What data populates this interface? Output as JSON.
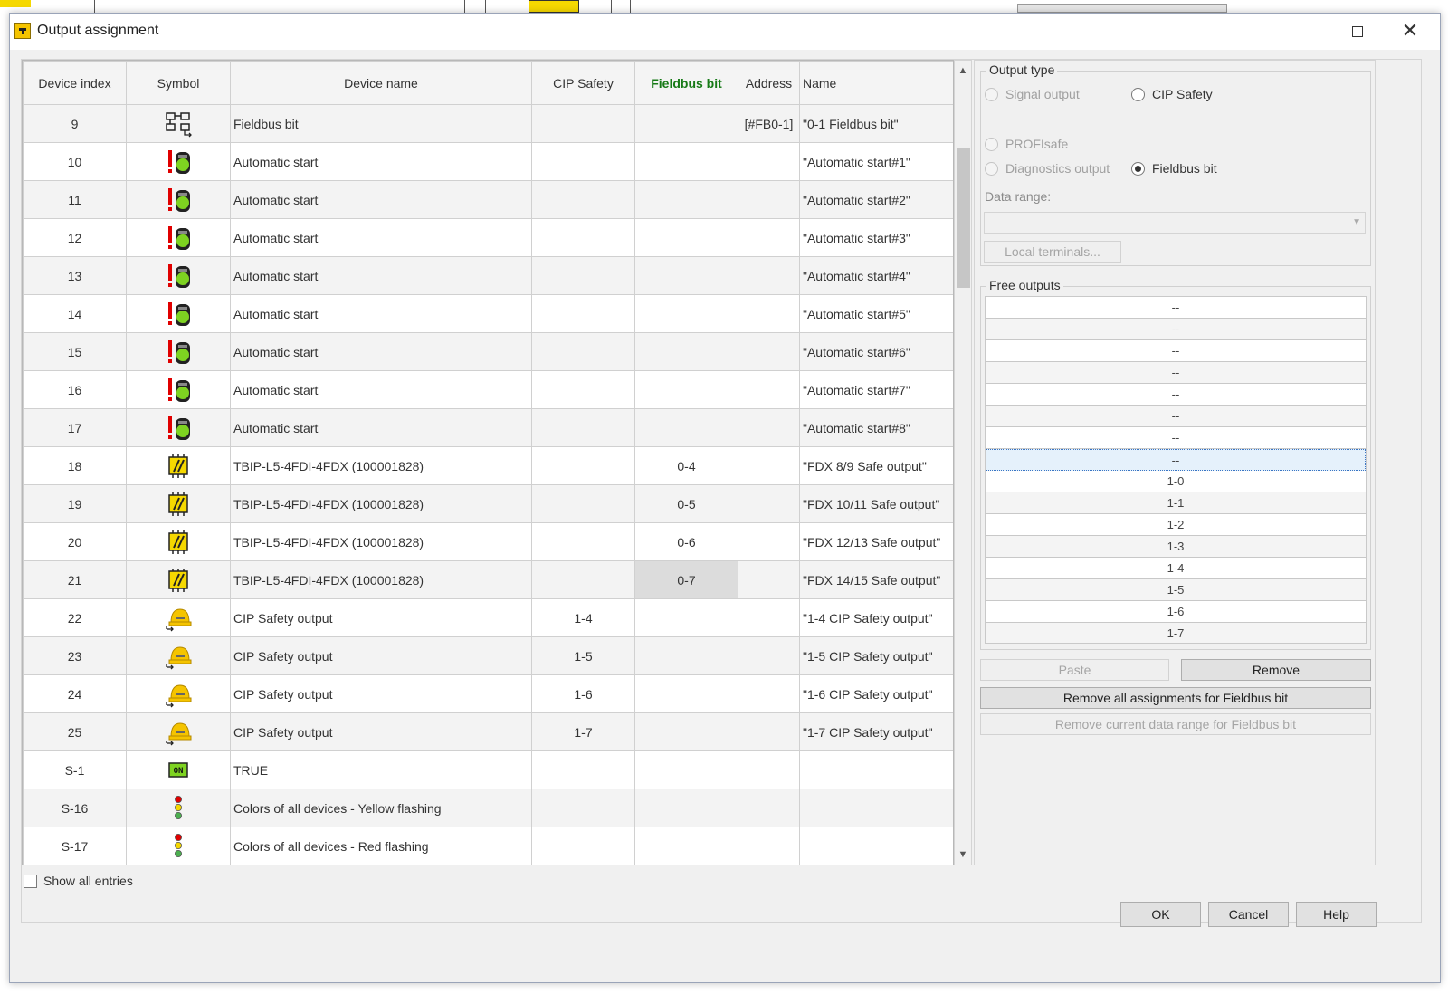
{
  "window": {
    "title": "Output assignment"
  },
  "columns": [
    "Device index",
    "Symbol",
    "Device name",
    "CIP Safety",
    "Fieldbus bit",
    "Address",
    "Name"
  ],
  "rows": [
    {
      "index": "9",
      "icon": "fieldbus-icon",
      "device": "Fieldbus bit",
      "cip": "",
      "fb": "",
      "addr": "[#FB0-1]",
      "name": "\"0-1 Fieldbus bit\""
    },
    {
      "index": "10",
      "icon": "automatic-start-icon",
      "device": "Automatic start",
      "cip": "",
      "fb": "",
      "addr": "",
      "name": "\"Automatic start#1\""
    },
    {
      "index": "11",
      "icon": "automatic-start-icon",
      "device": "Automatic start",
      "cip": "",
      "fb": "",
      "addr": "",
      "name": "\"Automatic start#2\""
    },
    {
      "index": "12",
      "icon": "automatic-start-icon",
      "device": "Automatic start",
      "cip": "",
      "fb": "",
      "addr": "",
      "name": "\"Automatic start#3\""
    },
    {
      "index": "13",
      "icon": "automatic-start-icon",
      "device": "Automatic start",
      "cip": "",
      "fb": "",
      "addr": "",
      "name": "\"Automatic start#4\""
    },
    {
      "index": "14",
      "icon": "automatic-start-icon",
      "device": "Automatic start",
      "cip": "",
      "fb": "",
      "addr": "",
      "name": "\"Automatic start#5\""
    },
    {
      "index": "15",
      "icon": "automatic-start-icon",
      "device": "Automatic start",
      "cip": "",
      "fb": "",
      "addr": "",
      "name": "\"Automatic start#6\""
    },
    {
      "index": "16",
      "icon": "automatic-start-icon",
      "device": "Automatic start",
      "cip": "",
      "fb": "",
      "addr": "",
      "name": "\"Automatic start#7\""
    },
    {
      "index": "17",
      "icon": "automatic-start-icon",
      "device": "Automatic start",
      "cip": "",
      "fb": "",
      "addr": "",
      "name": "\"Automatic start#8\""
    },
    {
      "index": "18",
      "icon": "safe-output-module-icon",
      "device": "TBIP-L5-4FDI-4FDX (100001828)",
      "cip": "",
      "fb": "0-4",
      "addr": "",
      "name": "\"FDX 8/9 Safe output\""
    },
    {
      "index": "19",
      "icon": "safe-output-module-icon",
      "device": "TBIP-L5-4FDI-4FDX (100001828)",
      "cip": "",
      "fb": "0-5",
      "addr": "",
      "name": "\"FDX 10/11 Safe output\""
    },
    {
      "index": "20",
      "icon": "safe-output-module-icon",
      "device": "TBIP-L5-4FDI-4FDX (100001828)",
      "cip": "",
      "fb": "0-6",
      "addr": "",
      "name": "\"FDX 12/13 Safe output\""
    },
    {
      "index": "21",
      "icon": "safe-output-module-icon",
      "device": "TBIP-L5-4FDI-4FDX (100001828)",
      "cip": "",
      "fb": "0-7",
      "addr": "",
      "name": "\"FDX 14/15 Safe output\"",
      "selected_cell": "fb"
    },
    {
      "index": "22",
      "icon": "cip-safety-output-icon",
      "device": "CIP Safety output",
      "cip": "1-4",
      "fb": "",
      "addr": "",
      "name": "\"1-4 CIP Safety output\""
    },
    {
      "index": "23",
      "icon": "cip-safety-output-icon",
      "device": "CIP Safety output",
      "cip": "1-5",
      "fb": "",
      "addr": "",
      "name": "\"1-5 CIP Safety output\""
    },
    {
      "index": "24",
      "icon": "cip-safety-output-icon",
      "device": "CIP Safety output",
      "cip": "1-6",
      "fb": "",
      "addr": "",
      "name": "\"1-6 CIP Safety output\""
    },
    {
      "index": "25",
      "icon": "cip-safety-output-icon",
      "device": "CIP Safety output",
      "cip": "1-7",
      "fb": "",
      "addr": "",
      "name": "\"1-7 CIP Safety output\""
    },
    {
      "index": "S-1",
      "icon": "true-on-icon",
      "icon_text": "ON",
      "device": "TRUE",
      "cip": "",
      "fb": "",
      "addr": "",
      "name": ""
    },
    {
      "index": "S-16",
      "icon": "traffic-light-icon",
      "device": "Colors of all devices - Yellow flashing",
      "cip": "",
      "fb": "",
      "addr": "",
      "name": ""
    },
    {
      "index": "S-17",
      "icon": "traffic-light-icon",
      "device": "Colors of all devices - Red flashing",
      "cip": "",
      "fb": "",
      "addr": "",
      "name": ""
    }
  ],
  "show_all": {
    "label": "Show all entries",
    "checked": false
  },
  "output_type": {
    "legend": "Output type",
    "options": [
      {
        "label": "Signal output",
        "enabled": false,
        "checked": false
      },
      {
        "label": "CIP Safety",
        "enabled": true,
        "checked": false
      },
      {
        "label": "PROFIsafe",
        "enabled": false,
        "checked": false
      },
      {
        "label": "Diagnostics output",
        "enabled": false,
        "checked": false
      },
      {
        "label": "Fieldbus bit",
        "enabled": true,
        "checked": true
      }
    ],
    "data_range_label": "Data range:",
    "data_range_value": "",
    "local_terminals_label": "Local terminals..."
  },
  "free_outputs": {
    "legend": "Free outputs",
    "items": [
      "--",
      "--",
      "--",
      "--",
      "--",
      "--",
      "--",
      "--",
      "1-0",
      "1-1",
      "1-2",
      "1-3",
      "1-4",
      "1-5",
      "1-6",
      "1-7"
    ],
    "selected_index": 7
  },
  "buttons": {
    "paste": "Paste",
    "remove": "Remove",
    "remove_all": "Remove all assignments for Fieldbus bit",
    "remove_current": "Remove current data range for Fieldbus bit",
    "ok": "OK",
    "cancel": "Cancel",
    "help": "Help"
  },
  "colors": {
    "fieldbus_header": "#177a17",
    "selection": "#e5f1fb",
    "title_icon": "#f5c400"
  }
}
